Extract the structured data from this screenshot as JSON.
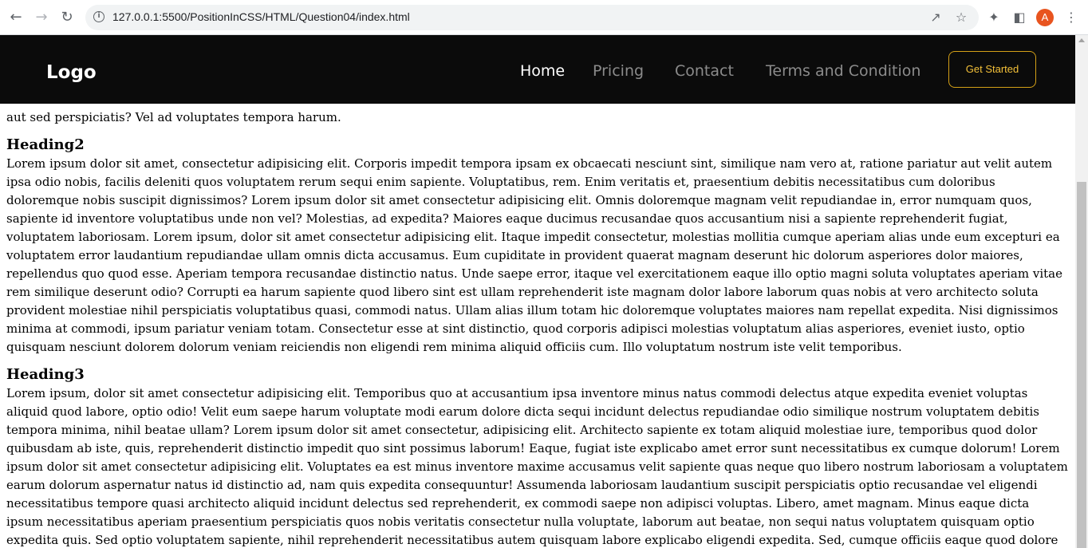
{
  "browser": {
    "url": "127.0.0.1:5500/PositionInCSS/HTML/Question04/index.html",
    "profile_initial": "A",
    "icons": [
      "back-icon",
      "forward-icon",
      "reload-icon",
      "site-info-icon",
      "share-icon",
      "bookmark-star-icon",
      "extensions-icon",
      "side-panel-icon",
      "profile-avatar",
      "more-menu-icon"
    ]
  },
  "header": {
    "logo": "Logo",
    "nav": [
      "Home",
      "Pricing",
      "Contact",
      "Terms and Condition"
    ],
    "active": "Home",
    "cta": "Get Started",
    "colors": {
      "background": "#0b0b0b",
      "active": "#ffffff",
      "inactive": "#8b8b8b",
      "cta": "#f3c039"
    }
  },
  "content": {
    "partial_top": "aut sed perspiciatis? Vel ad voluptates tempora harum.",
    "sections": [
      {
        "heading": "Heading2",
        "body": "Lorem ipsum dolor sit amet, consectetur adipisicing elit. Corporis impedit tempora ipsam ex obcaecati nesciunt sint, similique nam vero at, ratione pariatur aut velit autem ipsa odio nobis, facilis deleniti quos voluptatem rerum sequi enim sapiente. Voluptatibus, rem. Enim veritatis et, praesentium debitis necessitatibus cum doloribus doloremque nobis suscipit dignissimos? Lorem ipsum dolor sit amet consectetur adipisicing elit. Omnis doloremque magnam velit repudiandae in, error numquam quos, sapiente id inventore voluptatibus unde non vel? Molestias, ad expedita? Maiores eaque ducimus recusandae quos accusantium nisi a sapiente reprehenderit fugiat, voluptatem laboriosam. Lorem ipsum, dolor sit amet consectetur adipisicing elit. Itaque impedit consectetur, molestias mollitia cumque aperiam alias unde eum excepturi ea voluptatem error laudantium repudiandae ullam omnis dicta accusamus. Eum cupiditate in provident quaerat magnam deserunt hic dolorum asperiores dolor maiores, repellendus quo quod esse. Aperiam tempora recusandae distinctio natus. Unde saepe error, itaque vel exercitationem eaque illo optio magni soluta voluptates aperiam vitae rem similique deserunt odio? Corrupti ea harum sapiente quod libero sint est ullam reprehenderit iste magnam dolor labore laborum quas nobis at vero architecto soluta provident molestiae nihil perspiciatis voluptatibus quasi, commodi natus. Ullam alias illum totam hic doloremque voluptates maiores nam repellat expedita. Nisi dignissimos minima at commodi, ipsum pariatur veniam totam. Consectetur esse at sint distinctio, quod corporis adipisci molestias voluptatum alias asperiores, eveniet iusto, optio quisquam nesciunt dolorem dolorum veniam reiciendis non eligendi rem minima aliquid officiis cum. Illo voluptatum nostrum iste velit temporibus."
      },
      {
        "heading": "Heading3",
        "body": "Lorem ipsum, dolor sit amet consectetur adipisicing elit. Temporibus quo at accusantium ipsa inventore minus natus commodi delectus atque expedita eveniet voluptas aliquid quod labore, optio odio! Velit eum saepe harum voluptate modi earum dolore dicta sequi incidunt delectus repudiandae odio similique nostrum voluptatem debitis tempora minima, nihil beatae ullam? Lorem ipsum dolor sit amet consectetur, adipisicing elit. Architecto sapiente ex totam aliquid molestiae iure, temporibus quod dolor quibusdam ab iste, quis, reprehenderit distinctio impedit quo sint possimus laborum! Eaque, fugiat iste explicabo amet error sunt necessitatibus ex cumque dolorum! Lorem ipsum dolor sit amet consectetur adipisicing elit. Voluptates ea est minus inventore maxime accusamus velit sapiente quas neque quo libero nostrum laboriosam a voluptatem earum dolorum aspernatur natus id distinctio ad, nam quis expedita consequuntur! Assumenda laboriosam laudantium suscipit perspiciatis optio recusandae vel eligendi necessitatibus tempore quasi architecto aliquid incidunt delectus sed reprehenderit, ex commodi saepe non adipisci voluptas. Libero, amet magnam. Minus eaque dicta ipsum necessitatibus aperiam praesentium perspiciatis quos nobis veritatis consectetur nulla voluptate, laborum aut beatae, non sequi natus voluptatem quisquam optio expedita quis. Sed optio voluptatem sapiente, nihil reprehenderit necessitatibus autem quisquam labore explicabo eligendi expedita. Sed, cumque officiis eaque quod dolore nihil rem quidem nemo nesciunt illum accusamus et"
      }
    ]
  }
}
